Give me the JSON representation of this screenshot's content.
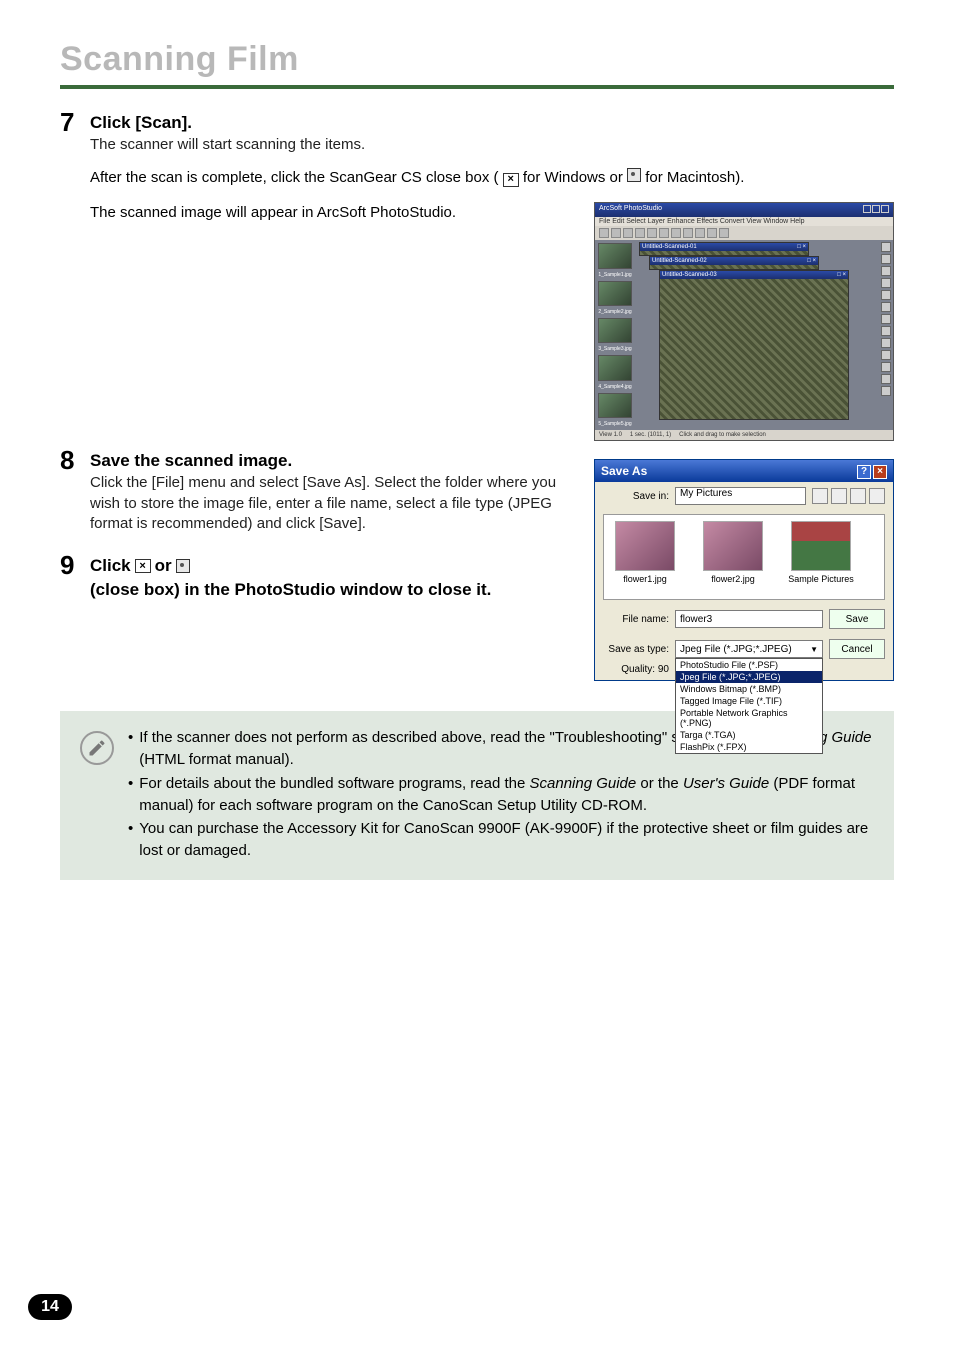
{
  "page_title": "Scanning Film",
  "steps": {
    "s7": {
      "num": "7",
      "head": "Click [Scan].",
      "sub": "The scanner will start scanning the items.",
      "p1_a": "After the scan is complete, click the ScanGear CS close box (",
      "p1_b": " for Windows or ",
      "p1_c": " for Macintosh).",
      "p2": "The scanned image will appear in ArcSoft PhotoStudio."
    },
    "s8": {
      "num": "8",
      "head": "Save the scanned image.",
      "sub": "Click the [File] menu and select [Save As]. Select the folder where you wish to store the image file, enter a file name, select a file type (JPEG format is recommended) and click [Save]."
    },
    "s9": {
      "num": "9",
      "head_a": "Click ",
      "head_b": " or ",
      "head_c": " (close box) in the PhotoStudio window to close it."
    }
  },
  "app": {
    "title": "ArcSoft PhotoStudio",
    "menubar": "File  Edit  Select  Layer  Enhance  Effects  Convert  View  Window  Help",
    "doc1": "Untitled-Scanned-01",
    "doc2": "Untitled-Scanned-02",
    "doc3": "Untitled-Scanned-03",
    "thumbs": [
      "1_Sample1.jpg",
      "2_Sample2.jpg",
      "3_Sample3.jpg",
      "4_Sample4.jpg",
      "5_Sample5.jpg"
    ],
    "status_left": "View 1.0",
    "status_mid": "1 sec. (1011, 1)",
    "status_right": "Click and drag to make selection"
  },
  "saveas": {
    "title": "Save As",
    "savein_label": "Save in:",
    "savein_value": "My Pictures",
    "items": [
      "flower1.jpg",
      "flower2.jpg",
      "Sample Pictures"
    ],
    "filename_label": "File name:",
    "filename_value": "flower3",
    "type_label": "Save as type:",
    "type_value": "Jpeg File (*.JPG;*.JPEG)",
    "quality_label": "Quality: 90",
    "save_btn": "Save",
    "cancel_btn": "Cancel",
    "options": [
      "PhotoStudio File (*.PSF)",
      "Jpeg File (*.JPG;*.JPEG)",
      "Windows Bitmap (*.BMP)",
      "Tagged Image File (*.TIF)",
      "Portable Network Graphics (*.PNG)",
      "Targa (*.TGA)",
      "FlashPix (*.FPX)"
    ]
  },
  "notes": {
    "b1_a": "If the scanner does not perform as described above, read the \"Troubleshooting\" section of the ",
    "b1_b": "Scanning Guide",
    "b1_c": " (HTML format manual).",
    "b2_a": "For details about the bundled software programs, read the ",
    "b2_b": "Scanning Guide",
    "b2_c": " or the ",
    "b2_d": "User's Guide",
    "b2_e": " (PDF format manual) for each software program on the CanoScan Setup Utility CD-ROM.",
    "b3": "You can purchase the Accessory Kit for CanoScan 9900F (AK-9900F) if the protective sheet or film guides are lost or damaged."
  },
  "page_num": "14"
}
